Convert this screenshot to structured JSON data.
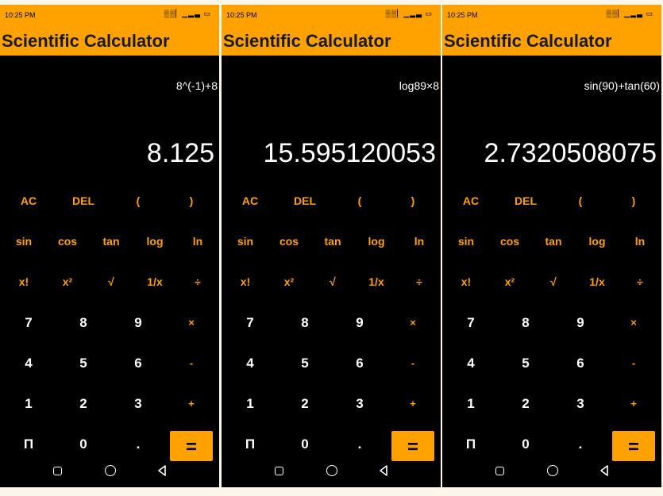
{
  "app_title": "Scientific Calculator",
  "status_time": "10:25 PM",
  "status_icons": [
    "network-icon",
    "signal-icon",
    "battery-icon"
  ],
  "status_text": "▒▒▏▁▂▃ ▭",
  "accent_color": "#ffa200",
  "screens": [
    {
      "expression": "8^(-1)+8",
      "result": "8.125"
    },
    {
      "expression": "log89×8",
      "result": "15.595120053"
    },
    {
      "expression": "sin(90)+tan(60)",
      "result": "2.7320508075"
    }
  ],
  "keys": {
    "ac": "AC",
    "del": "DEL",
    "lparen": "(",
    "rparen": ")",
    "sin": "sin",
    "cos": "cos",
    "tan": "tan",
    "log": "log",
    "ln": "ln",
    "fact": "x!",
    "square": "x²",
    "sqrt": "√",
    "recip": "1/x",
    "divide": "÷",
    "n7": "7",
    "n8": "8",
    "n9": "9",
    "multiply": "×",
    "n4": "4",
    "n5": "5",
    "n6": "6",
    "minus": "-",
    "n1": "1",
    "n2": "2",
    "n3": "3",
    "plus": "+",
    "pi": "Π",
    "n0": "0",
    "dot": ".",
    "equals": "="
  }
}
